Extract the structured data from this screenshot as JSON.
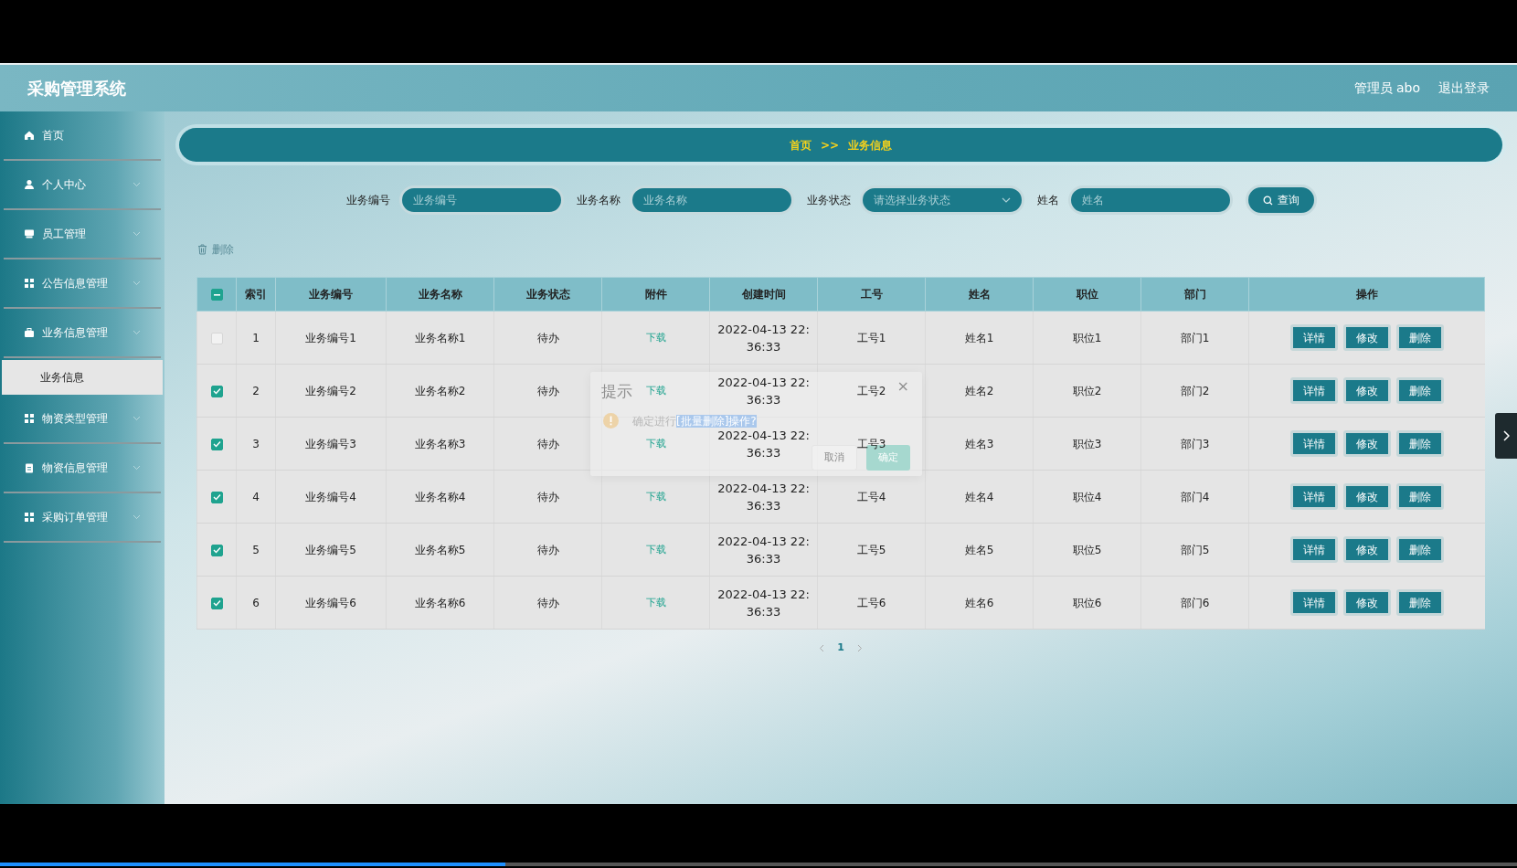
{
  "header": {
    "title": "采购管理系统",
    "user": "管理员 abo",
    "logout": "退出登录"
  },
  "sidebar": {
    "items": [
      {
        "label": "首页",
        "kind": "link"
      },
      {
        "label": "个人中心",
        "kind": "menu"
      },
      {
        "label": "员工管理",
        "kind": "menu"
      },
      {
        "label": "公告信息管理",
        "kind": "menu"
      },
      {
        "label": "业务信息管理",
        "kind": "menu",
        "children": [
          {
            "label": "业务信息",
            "selected": true
          }
        ]
      },
      {
        "label": "物资类型管理",
        "kind": "menu"
      },
      {
        "label": "物资信息管理",
        "kind": "menu"
      },
      {
        "label": "采购订单管理",
        "kind": "menu"
      }
    ]
  },
  "breadcrumb": {
    "items": [
      "首页",
      "业务信息"
    ],
    "separator": ">>"
  },
  "filters": [
    {
      "label": "业务编号",
      "placeholder": "业务编号",
      "kind": "text"
    },
    {
      "label": "业务名称",
      "placeholder": "业务名称",
      "kind": "text"
    },
    {
      "label": "业务状态",
      "placeholder": "请选择业务状态",
      "kind": "select"
    },
    {
      "label": "姓名",
      "placeholder": "姓名",
      "kind": "text"
    }
  ],
  "search_button": "查询",
  "toolbar": {
    "delete": "删除"
  },
  "table": {
    "select_all": {
      "indeterminate": true
    },
    "columns": [
      "索引",
      "业务编号",
      "业务名称",
      "业务状态",
      "附件",
      "创建时间",
      "工号",
      "姓名",
      "职位",
      "部门",
      "操作"
    ],
    "rows": [
      {
        "selected": false,
        "cells": [
          "1",
          "业务编号1",
          "业务名称1",
          "待办",
          "下载",
          "2022-04-13 22:36:33",
          "工号1",
          "姓名1",
          "职位1",
          "部门1"
        ],
        "actions": [
          "详情",
          "修改",
          "删除"
        ]
      },
      {
        "selected": true,
        "cells": [
          "2",
          "业务编号2",
          "业务名称2",
          "待办",
          "下载",
          "2022-04-13 22:36:33",
          "工号2",
          "姓名2",
          "职位2",
          "部门2"
        ],
        "actions": [
          "详情",
          "修改",
          "删除"
        ]
      },
      {
        "selected": true,
        "cells": [
          "3",
          "业务编号3",
          "业务名称3",
          "待办",
          "下载",
          "2022-04-13 22:36:33",
          "工号3",
          "姓名3",
          "职位3",
          "部门3"
        ],
        "actions": [
          "详情",
          "修改",
          "删除"
        ]
      },
      {
        "selected": true,
        "cells": [
          "4",
          "业务编号4",
          "业务名称4",
          "待办",
          "下载",
          "2022-04-13 22:36:33",
          "工号4",
          "姓名4",
          "职位4",
          "部门4"
        ],
        "actions": [
          "详情",
          "修改",
          "删除"
        ]
      },
      {
        "selected": true,
        "cells": [
          "5",
          "业务编号5",
          "业务名称5",
          "待办",
          "下载",
          "2022-04-13 22:36:33",
          "工号5",
          "姓名5",
          "职位5",
          "部门5"
        ],
        "actions": [
          "详情",
          "修改",
          "删除"
        ]
      },
      {
        "selected": true,
        "cells": [
          "6",
          "业务编号6",
          "业务名称6",
          "待办",
          "下载",
          "2022-04-13 22:36:33",
          "工号6",
          "姓名6",
          "职位6",
          "部门6"
        ],
        "actions": [
          "详情",
          "修改",
          "删除"
        ]
      }
    ]
  },
  "pagination": {
    "pages": [
      {
        "label": "1",
        "selected": true
      }
    ]
  },
  "dialog": {
    "title": "提示",
    "close": "×",
    "message": [
      {
        "text": "确定进行",
        "selected": false
      },
      {
        "text": "[批量删除]操作?",
        "selected": true
      }
    ],
    "cancel": "取消",
    "confirm": "确定"
  },
  "video_progress": {
    "level": 0.333
  }
}
